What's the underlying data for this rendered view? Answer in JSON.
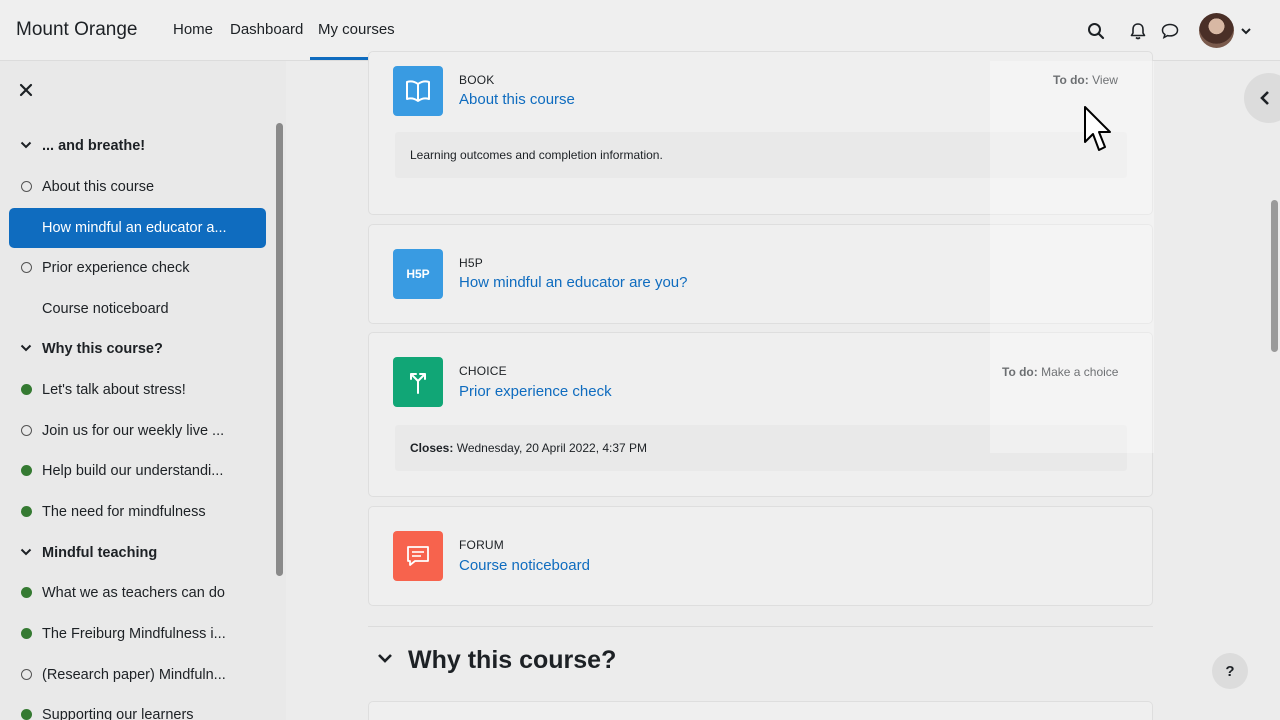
{
  "navbar": {
    "brand": "Mount Orange",
    "links": [
      {
        "label": "Home"
      },
      {
        "label": "Dashboard"
      },
      {
        "label": "My courses",
        "active": true
      }
    ],
    "icons": [
      "search-icon",
      "bell-icon",
      "chat-icon",
      "avatar",
      "chevron-down-icon"
    ]
  },
  "sidebar": {
    "close_icon": "close-icon",
    "items": [
      {
        "label": "... and breathe!",
        "kind": "section"
      },
      {
        "label": "About this course",
        "kind": "activity",
        "status": "incomplete"
      },
      {
        "label": "How mindful an educator a...",
        "kind": "activity",
        "status": "current"
      },
      {
        "label": "Prior experience check",
        "kind": "activity",
        "status": "incomplete"
      },
      {
        "label": "Course noticeboard",
        "kind": "activity",
        "status": "none"
      },
      {
        "label": "Why this course?",
        "kind": "section"
      },
      {
        "label": "Let's talk about stress!",
        "kind": "activity",
        "status": "complete"
      },
      {
        "label": "Join us for our weekly live ...",
        "kind": "activity",
        "status": "incomplete"
      },
      {
        "label": "Help build our understandi...",
        "kind": "activity",
        "status": "complete"
      },
      {
        "label": "The need for mindfulness",
        "kind": "activity",
        "status": "complete"
      },
      {
        "label": "Mindful teaching",
        "kind": "section"
      },
      {
        "label": "What we as teachers can do",
        "kind": "activity",
        "status": "complete"
      },
      {
        "label": "The Freiburg Mindfulness i...",
        "kind": "activity",
        "status": "complete"
      },
      {
        "label": "(Research paper) Mindfuln...",
        "kind": "activity",
        "status": "incomplete"
      },
      {
        "label": "Supporting our learners",
        "kind": "activity",
        "status": "complete"
      }
    ]
  },
  "main": {
    "activities": [
      {
        "type": "BOOK",
        "name": "About this course",
        "todo_label": "To do:",
        "todo_value": "View",
        "description": "Learning outcomes and completion information.",
        "color": "#399be2"
      },
      {
        "type": "H5P",
        "name": "How mindful an educator are you?",
        "icon_text": "H5P",
        "color": "#399be2"
      },
      {
        "type": "CHOICE",
        "name": "Prior experience check",
        "todo_label": "To do:",
        "todo_value": "Make a choice",
        "closes_label": "Closes:",
        "closes_value": "Wednesday, 20 April 2022, 4:37 PM",
        "color": "#11a676"
      },
      {
        "type": "FORUM",
        "name": "Course noticeboard",
        "color": "#f7634d"
      }
    ],
    "section_title": "Why this course?"
  },
  "help_label": "?",
  "colors": {
    "primary": "#0f6cbf",
    "complete": "#357a32"
  }
}
